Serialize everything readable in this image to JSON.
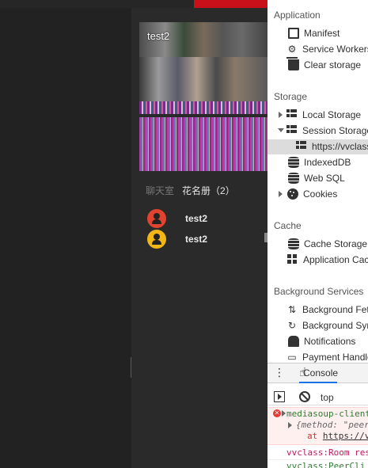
{
  "app": {
    "video": {
      "participant_name": "test2"
    },
    "tabs": {
      "chat": "聊天室",
      "roster": "花名册（2）"
    },
    "roster": [
      {
        "name": "test2",
        "avatar_color": "#e2432f"
      },
      {
        "name": "test2",
        "avatar_color": "#f2b617"
      }
    ],
    "collapse_glyph": "›"
  },
  "devtools": {
    "sections": {
      "application": "Application",
      "storage": "Storage",
      "cache": "Cache",
      "background": "Background Services"
    },
    "application_items": [
      "Manifest",
      "Service Workers",
      "Clear storage"
    ],
    "storage_items": {
      "local_storage": "Local Storage",
      "session_storage": "Session Storage",
      "session_origin": "https://vvclass",
      "indexeddb": "IndexedDB",
      "websql": "Web SQL",
      "cookies": "Cookies"
    },
    "cache_items": [
      "Cache Storage",
      "Application Cache"
    ],
    "background_items": [
      "Background Fetch",
      "Background Sync",
      "Notifications",
      "Payment Handler"
    ],
    "drawer": {
      "more": "⋮",
      "tab": "Console"
    },
    "console": {
      "context": "top",
      "error_line1": "mediasoup-client",
      "error_line2": "{method: \"peer",
      "error_line3_prefix": "at",
      "error_line3_link": "https://v",
      "info_line1": "vvclass:Room res",
      "info_line2": "vvclass:PeerCli"
    }
  }
}
